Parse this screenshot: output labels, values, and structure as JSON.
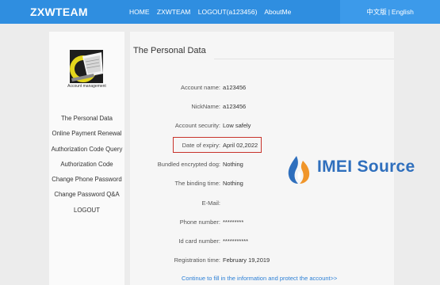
{
  "header": {
    "brand": "ZXWTEAM",
    "nav": [
      "HOME",
      "ZXWTEAM",
      "LOGOUT(a123456)",
      "AboutMe"
    ],
    "lang_cn": "中文版",
    "lang_sep": "|",
    "lang_en": "English"
  },
  "sidebar": {
    "account_management": "Account management",
    "items": [
      "The Personal Data",
      "Online Payment Renewal",
      "Authorization Code Query",
      "Authorization Code",
      "Change Phone Password",
      "Change Password Q&A",
      "LOGOUT"
    ]
  },
  "main": {
    "title": "The Personal Data",
    "fields": [
      {
        "label": "Account name:",
        "value": "a123456"
      },
      {
        "label": "NickName:",
        "value": "a123456"
      },
      {
        "label": "Account security:",
        "value": "Low safely"
      },
      {
        "label": "Date of expiry:",
        "value": "April 02,2022"
      },
      {
        "label": "Bundled encrypted dog:",
        "value": "Nothing"
      },
      {
        "label": "The binding time:",
        "value": "Nothing"
      },
      {
        "label": "E-Mail:",
        "value": ""
      },
      {
        "label": "Phone number:",
        "value": "*********"
      },
      {
        "label": "Id card number:",
        "value": "***********"
      },
      {
        "label": "Registration time:",
        "value": "February 19,2019"
      }
    ],
    "footer_link": "Continue to fill in the information and protect the account>>"
  },
  "watermark": {
    "text": "IMEI Source",
    "color": "#2f6fbd"
  },
  "colors": {
    "header": "#2f8ee0",
    "highlight": "#c8332b",
    "link": "#2b7fd6"
  }
}
